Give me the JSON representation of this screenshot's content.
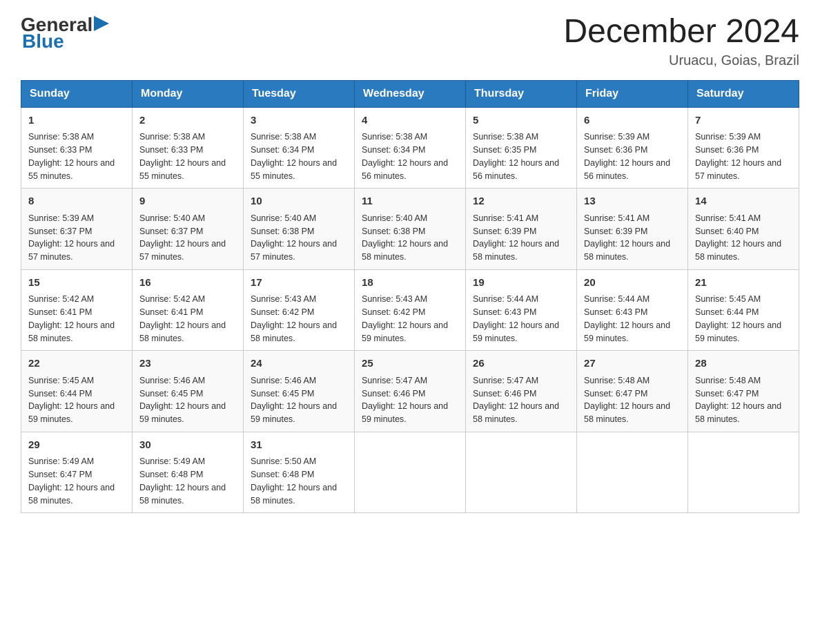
{
  "logo": {
    "text_general": "General",
    "text_blue": "Blue",
    "triangle_symbol": "▶"
  },
  "title": "December 2024",
  "subtitle": "Uruacu, Goias, Brazil",
  "headers": [
    "Sunday",
    "Monday",
    "Tuesday",
    "Wednesday",
    "Thursday",
    "Friday",
    "Saturday"
  ],
  "weeks": [
    [
      {
        "day": "1",
        "sunrise": "5:38 AM",
        "sunset": "6:33 PM",
        "daylight": "12 hours and 55 minutes"
      },
      {
        "day": "2",
        "sunrise": "5:38 AM",
        "sunset": "6:33 PM",
        "daylight": "12 hours and 55 minutes"
      },
      {
        "day": "3",
        "sunrise": "5:38 AM",
        "sunset": "6:34 PM",
        "daylight": "12 hours and 55 minutes"
      },
      {
        "day": "4",
        "sunrise": "5:38 AM",
        "sunset": "6:34 PM",
        "daylight": "12 hours and 56 minutes"
      },
      {
        "day": "5",
        "sunrise": "5:38 AM",
        "sunset": "6:35 PM",
        "daylight": "12 hours and 56 minutes"
      },
      {
        "day": "6",
        "sunrise": "5:39 AM",
        "sunset": "6:36 PM",
        "daylight": "12 hours and 56 minutes"
      },
      {
        "day": "7",
        "sunrise": "5:39 AM",
        "sunset": "6:36 PM",
        "daylight": "12 hours and 57 minutes"
      }
    ],
    [
      {
        "day": "8",
        "sunrise": "5:39 AM",
        "sunset": "6:37 PM",
        "daylight": "12 hours and 57 minutes"
      },
      {
        "day": "9",
        "sunrise": "5:40 AM",
        "sunset": "6:37 PM",
        "daylight": "12 hours and 57 minutes"
      },
      {
        "day": "10",
        "sunrise": "5:40 AM",
        "sunset": "6:38 PM",
        "daylight": "12 hours and 57 minutes"
      },
      {
        "day": "11",
        "sunrise": "5:40 AM",
        "sunset": "6:38 PM",
        "daylight": "12 hours and 58 minutes"
      },
      {
        "day": "12",
        "sunrise": "5:41 AM",
        "sunset": "6:39 PM",
        "daylight": "12 hours and 58 minutes"
      },
      {
        "day": "13",
        "sunrise": "5:41 AM",
        "sunset": "6:39 PM",
        "daylight": "12 hours and 58 minutes"
      },
      {
        "day": "14",
        "sunrise": "5:41 AM",
        "sunset": "6:40 PM",
        "daylight": "12 hours and 58 minutes"
      }
    ],
    [
      {
        "day": "15",
        "sunrise": "5:42 AM",
        "sunset": "6:41 PM",
        "daylight": "12 hours and 58 minutes"
      },
      {
        "day": "16",
        "sunrise": "5:42 AM",
        "sunset": "6:41 PM",
        "daylight": "12 hours and 58 minutes"
      },
      {
        "day": "17",
        "sunrise": "5:43 AM",
        "sunset": "6:42 PM",
        "daylight": "12 hours and 58 minutes"
      },
      {
        "day": "18",
        "sunrise": "5:43 AM",
        "sunset": "6:42 PM",
        "daylight": "12 hours and 59 minutes"
      },
      {
        "day": "19",
        "sunrise": "5:44 AM",
        "sunset": "6:43 PM",
        "daylight": "12 hours and 59 minutes"
      },
      {
        "day": "20",
        "sunrise": "5:44 AM",
        "sunset": "6:43 PM",
        "daylight": "12 hours and 59 minutes"
      },
      {
        "day": "21",
        "sunrise": "5:45 AM",
        "sunset": "6:44 PM",
        "daylight": "12 hours and 59 minutes"
      }
    ],
    [
      {
        "day": "22",
        "sunrise": "5:45 AM",
        "sunset": "6:44 PM",
        "daylight": "12 hours and 59 minutes"
      },
      {
        "day": "23",
        "sunrise": "5:46 AM",
        "sunset": "6:45 PM",
        "daylight": "12 hours and 59 minutes"
      },
      {
        "day": "24",
        "sunrise": "5:46 AM",
        "sunset": "6:45 PM",
        "daylight": "12 hours and 59 minutes"
      },
      {
        "day": "25",
        "sunrise": "5:47 AM",
        "sunset": "6:46 PM",
        "daylight": "12 hours and 59 minutes"
      },
      {
        "day": "26",
        "sunrise": "5:47 AM",
        "sunset": "6:46 PM",
        "daylight": "12 hours and 58 minutes"
      },
      {
        "day": "27",
        "sunrise": "5:48 AM",
        "sunset": "6:47 PM",
        "daylight": "12 hours and 58 minutes"
      },
      {
        "day": "28",
        "sunrise": "5:48 AM",
        "sunset": "6:47 PM",
        "daylight": "12 hours and 58 minutes"
      }
    ],
    [
      {
        "day": "29",
        "sunrise": "5:49 AM",
        "sunset": "6:47 PM",
        "daylight": "12 hours and 58 minutes"
      },
      {
        "day": "30",
        "sunrise": "5:49 AM",
        "sunset": "6:48 PM",
        "daylight": "12 hours and 58 minutes"
      },
      {
        "day": "31",
        "sunrise": "5:50 AM",
        "sunset": "6:48 PM",
        "daylight": "12 hours and 58 minutes"
      },
      null,
      null,
      null,
      null
    ]
  ]
}
